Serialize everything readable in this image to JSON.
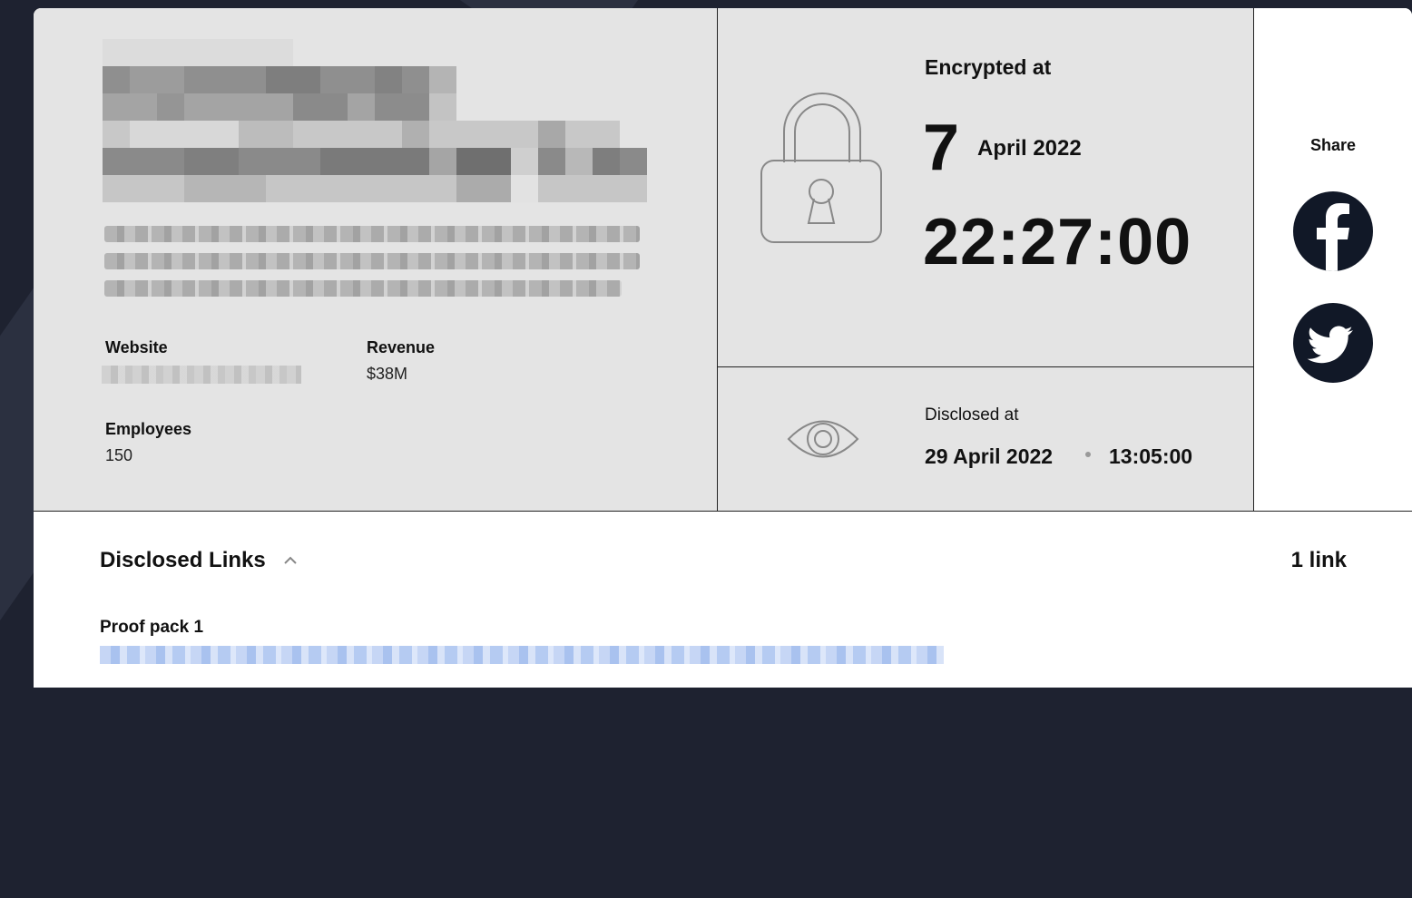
{
  "company": {
    "website_label": "Website",
    "revenue_label": "Revenue",
    "revenue_value": "$38M",
    "employees_label": "Employees",
    "employees_value": "150"
  },
  "encrypted": {
    "label": "Encrypted at",
    "day": "7",
    "month_year": "April 2022",
    "time": "22:27:00",
    "icon": "lock-icon"
  },
  "disclosed": {
    "label": "Disclosed at",
    "date": "29 April 2022",
    "time": "13:05:00",
    "icon": "eye-icon"
  },
  "share": {
    "label": "Share",
    "facebook_icon": "facebook-icon",
    "twitter_icon": "twitter-icon"
  },
  "links": {
    "title": "Disclosed Links",
    "count": "1 link",
    "items": [
      {
        "label": "Proof pack 1"
      }
    ]
  },
  "colors": {
    "panel": "#e4e4e4",
    "social_bg": "#111827",
    "page_bg": "#1e2230"
  }
}
